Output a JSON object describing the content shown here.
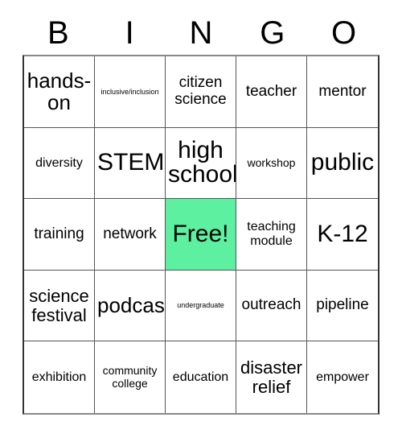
{
  "card": {
    "header_letters": [
      "B",
      "I",
      "N",
      "G",
      "O"
    ],
    "free_color": "#5cf0a0",
    "grid_border_color": "#555555",
    "background_color": "#ffffff",
    "columns": 5,
    "rows": 5,
    "cells": [
      {
        "text": "hands-\non",
        "size": "xl",
        "free": false
      },
      {
        "text": "inclusive/inclusion",
        "size": "xxs",
        "free": false
      },
      {
        "text": "citizen\nscience",
        "size": "md",
        "free": false
      },
      {
        "text": "teacher",
        "size": "md",
        "free": false
      },
      {
        "text": "mentor",
        "size": "md",
        "free": false
      },
      {
        "text": "diversity",
        "size": "sm",
        "free": false
      },
      {
        "text": "STEM",
        "size": "xxl",
        "free": false
      },
      {
        "text": "high\nschool",
        "size": "xxl",
        "free": false
      },
      {
        "text": "workshop",
        "size": "xs",
        "free": false
      },
      {
        "text": "public",
        "size": "xxl",
        "free": false
      },
      {
        "text": "training",
        "size": "md",
        "free": false
      },
      {
        "text": "network",
        "size": "md",
        "free": false
      },
      {
        "text": "Free!",
        "size": "xxl",
        "free": true
      },
      {
        "text": "teaching\nmodule",
        "size": "sm",
        "free": false
      },
      {
        "text": "K-12",
        "size": "xxl",
        "free": false
      },
      {
        "text": "science\nfestival",
        "size": "lg",
        "free": false
      },
      {
        "text": "podcast",
        "size": "xl",
        "free": false
      },
      {
        "text": "undergraduate",
        "size": "xxs",
        "free": false
      },
      {
        "text": "outreach",
        "size": "md",
        "free": false
      },
      {
        "text": "pipeline",
        "size": "md",
        "free": false
      },
      {
        "text": "exhibition",
        "size": "sm",
        "free": false
      },
      {
        "text": "community\ncollege",
        "size": "xs",
        "free": false
      },
      {
        "text": "education",
        "size": "sm",
        "free": false
      },
      {
        "text": "disaster\nrelief",
        "size": "lg",
        "free": false
      },
      {
        "text": "empower",
        "size": "sm",
        "free": false
      }
    ]
  }
}
